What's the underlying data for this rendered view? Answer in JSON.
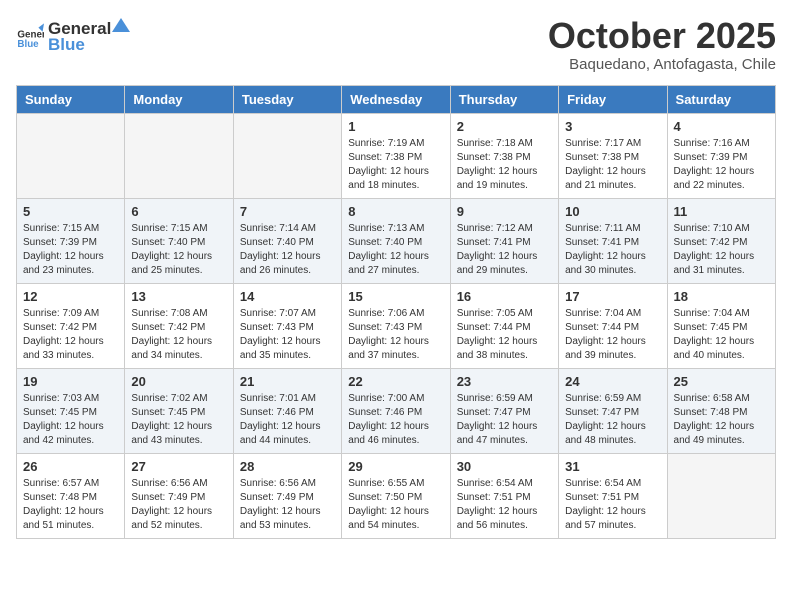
{
  "logo": {
    "general": "General",
    "blue": "Blue"
  },
  "header": {
    "month": "October 2025",
    "location": "Baquedano, Antofagasta, Chile"
  },
  "weekdays": [
    "Sunday",
    "Monday",
    "Tuesday",
    "Wednesday",
    "Thursday",
    "Friday",
    "Saturday"
  ],
  "weeks": [
    [
      {
        "day": "",
        "info": ""
      },
      {
        "day": "",
        "info": ""
      },
      {
        "day": "",
        "info": ""
      },
      {
        "day": "1",
        "info": "Sunrise: 7:19 AM\nSunset: 7:38 PM\nDaylight: 12 hours and 18 minutes."
      },
      {
        "day": "2",
        "info": "Sunrise: 7:18 AM\nSunset: 7:38 PM\nDaylight: 12 hours and 19 minutes."
      },
      {
        "day": "3",
        "info": "Sunrise: 7:17 AM\nSunset: 7:38 PM\nDaylight: 12 hours and 21 minutes."
      },
      {
        "day": "4",
        "info": "Sunrise: 7:16 AM\nSunset: 7:39 PM\nDaylight: 12 hours and 22 minutes."
      }
    ],
    [
      {
        "day": "5",
        "info": "Sunrise: 7:15 AM\nSunset: 7:39 PM\nDaylight: 12 hours and 23 minutes."
      },
      {
        "day": "6",
        "info": "Sunrise: 7:15 AM\nSunset: 7:40 PM\nDaylight: 12 hours and 25 minutes."
      },
      {
        "day": "7",
        "info": "Sunrise: 7:14 AM\nSunset: 7:40 PM\nDaylight: 12 hours and 26 minutes."
      },
      {
        "day": "8",
        "info": "Sunrise: 7:13 AM\nSunset: 7:40 PM\nDaylight: 12 hours and 27 minutes."
      },
      {
        "day": "9",
        "info": "Sunrise: 7:12 AM\nSunset: 7:41 PM\nDaylight: 12 hours and 29 minutes."
      },
      {
        "day": "10",
        "info": "Sunrise: 7:11 AM\nSunset: 7:41 PM\nDaylight: 12 hours and 30 minutes."
      },
      {
        "day": "11",
        "info": "Sunrise: 7:10 AM\nSunset: 7:42 PM\nDaylight: 12 hours and 31 minutes."
      }
    ],
    [
      {
        "day": "12",
        "info": "Sunrise: 7:09 AM\nSunset: 7:42 PM\nDaylight: 12 hours and 33 minutes."
      },
      {
        "day": "13",
        "info": "Sunrise: 7:08 AM\nSunset: 7:42 PM\nDaylight: 12 hours and 34 minutes."
      },
      {
        "day": "14",
        "info": "Sunrise: 7:07 AM\nSunset: 7:43 PM\nDaylight: 12 hours and 35 minutes."
      },
      {
        "day": "15",
        "info": "Sunrise: 7:06 AM\nSunset: 7:43 PM\nDaylight: 12 hours and 37 minutes."
      },
      {
        "day": "16",
        "info": "Sunrise: 7:05 AM\nSunset: 7:44 PM\nDaylight: 12 hours and 38 minutes."
      },
      {
        "day": "17",
        "info": "Sunrise: 7:04 AM\nSunset: 7:44 PM\nDaylight: 12 hours and 39 minutes."
      },
      {
        "day": "18",
        "info": "Sunrise: 7:04 AM\nSunset: 7:45 PM\nDaylight: 12 hours and 40 minutes."
      }
    ],
    [
      {
        "day": "19",
        "info": "Sunrise: 7:03 AM\nSunset: 7:45 PM\nDaylight: 12 hours and 42 minutes."
      },
      {
        "day": "20",
        "info": "Sunrise: 7:02 AM\nSunset: 7:45 PM\nDaylight: 12 hours and 43 minutes."
      },
      {
        "day": "21",
        "info": "Sunrise: 7:01 AM\nSunset: 7:46 PM\nDaylight: 12 hours and 44 minutes."
      },
      {
        "day": "22",
        "info": "Sunrise: 7:00 AM\nSunset: 7:46 PM\nDaylight: 12 hours and 46 minutes."
      },
      {
        "day": "23",
        "info": "Sunrise: 6:59 AM\nSunset: 7:47 PM\nDaylight: 12 hours and 47 minutes."
      },
      {
        "day": "24",
        "info": "Sunrise: 6:59 AM\nSunset: 7:47 PM\nDaylight: 12 hours and 48 minutes."
      },
      {
        "day": "25",
        "info": "Sunrise: 6:58 AM\nSunset: 7:48 PM\nDaylight: 12 hours and 49 minutes."
      }
    ],
    [
      {
        "day": "26",
        "info": "Sunrise: 6:57 AM\nSunset: 7:48 PM\nDaylight: 12 hours and 51 minutes."
      },
      {
        "day": "27",
        "info": "Sunrise: 6:56 AM\nSunset: 7:49 PM\nDaylight: 12 hours and 52 minutes."
      },
      {
        "day": "28",
        "info": "Sunrise: 6:56 AM\nSunset: 7:49 PM\nDaylight: 12 hours and 53 minutes."
      },
      {
        "day": "29",
        "info": "Sunrise: 6:55 AM\nSunset: 7:50 PM\nDaylight: 12 hours and 54 minutes."
      },
      {
        "day": "30",
        "info": "Sunrise: 6:54 AM\nSunset: 7:51 PM\nDaylight: 12 hours and 56 minutes."
      },
      {
        "day": "31",
        "info": "Sunrise: 6:54 AM\nSunset: 7:51 PM\nDaylight: 12 hours and 57 minutes."
      },
      {
        "day": "",
        "info": ""
      }
    ]
  ]
}
